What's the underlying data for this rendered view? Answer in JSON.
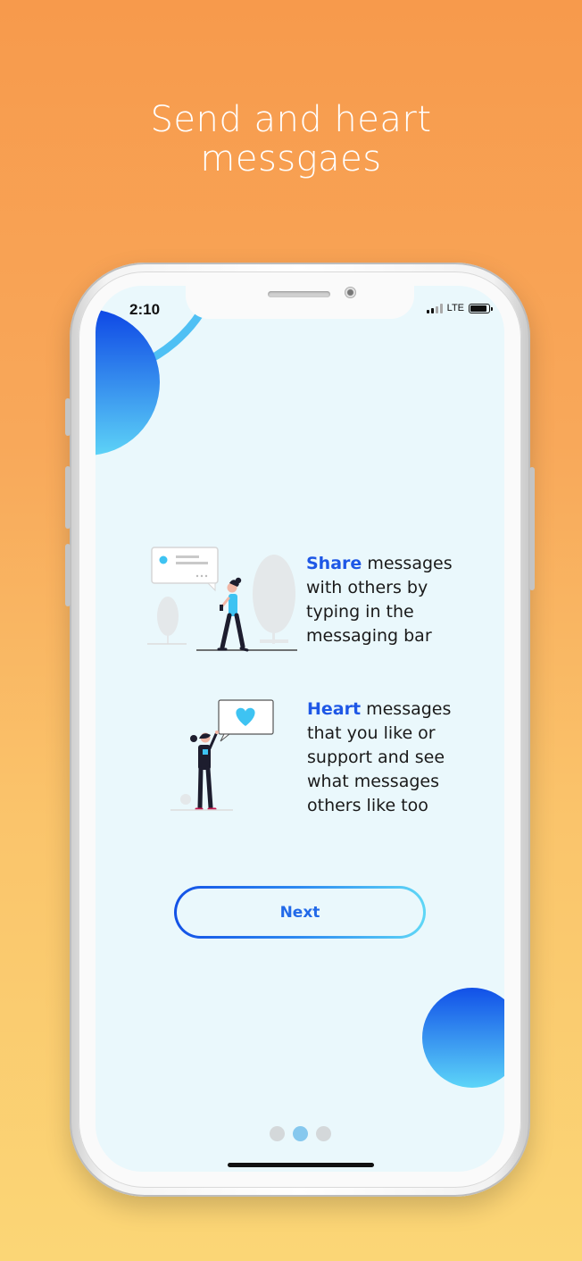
{
  "headline": {
    "line1": "Send and heart",
    "line2": "messgaes"
  },
  "status_bar": {
    "time": "2:10",
    "network": "LTE"
  },
  "features": [
    {
      "keyword": "Share",
      "text": " messages with others by typing in the messaging bar"
    },
    {
      "keyword": "Heart",
      "text": " messages that you like or support and see what messages others like too"
    }
  ],
  "next_button": {
    "label": "Next"
  },
  "pagination": {
    "count": 3,
    "active_index": 1
  },
  "colors": {
    "accent_blue": "#1E57E6",
    "gradient_start": "#1351E6",
    "gradient_end": "#5FD7F6",
    "screen_bg": "#EAF8FC",
    "background_top": "#F79A4C",
    "background_bottom": "#FBD676"
  }
}
